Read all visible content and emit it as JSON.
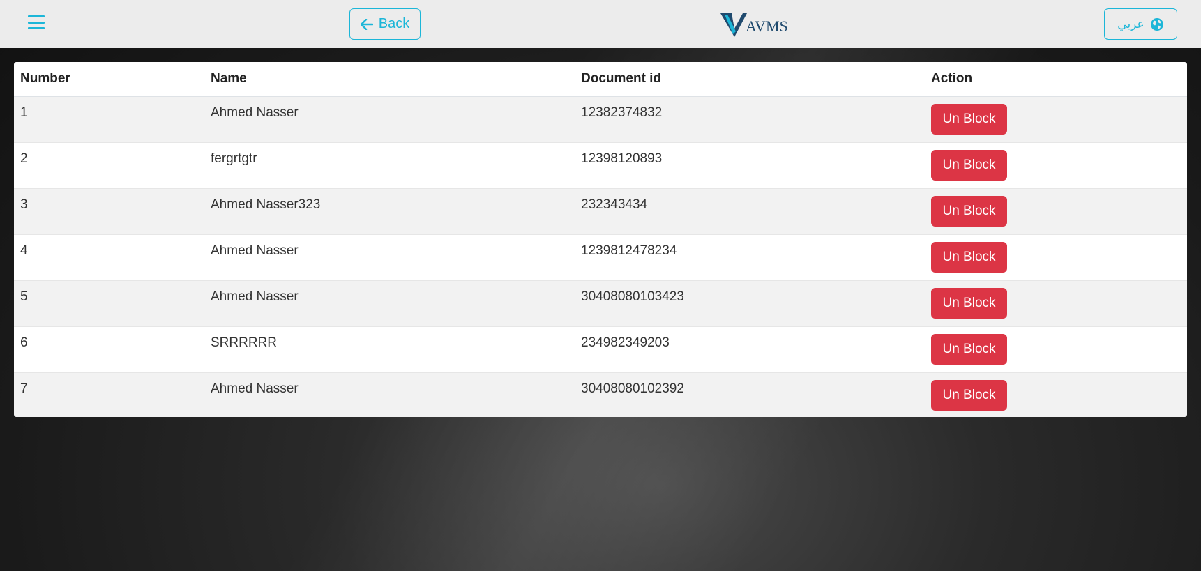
{
  "nav": {
    "back_label": "Back",
    "language_label": "عربي",
    "logo_text": "AVMS"
  },
  "table": {
    "headers": [
      "Number",
      "Name",
      "Document id",
      "Action"
    ],
    "rows": [
      {
        "number": "1",
        "name": "Ahmed Nasser",
        "document_id": "12382374832",
        "action": "Un Block"
      },
      {
        "number": "2",
        "name": "fergrtgtr",
        "document_id": "12398120893",
        "action": "Un Block"
      },
      {
        "number": "3",
        "name": "Ahmed Nasser323",
        "document_id": "232343434",
        "action": "Un Block"
      },
      {
        "number": "4",
        "name": "Ahmed Nasser",
        "document_id": "1239812478234",
        "action": "Un Block"
      },
      {
        "number": "5",
        "name": "Ahmed Nasser",
        "document_id": "30408080103423",
        "action": "Un Block"
      },
      {
        "number": "6",
        "name": "SRRRRRR",
        "document_id": "234982349203",
        "action": "Un Block"
      },
      {
        "number": "7",
        "name": "Ahmed Nasser",
        "document_id": "30408080102392",
        "action": "Un Block"
      }
    ]
  },
  "colors": {
    "accent": "#1cb6d8",
    "danger": "#dc3545",
    "navbar_bg": "#ececec"
  }
}
